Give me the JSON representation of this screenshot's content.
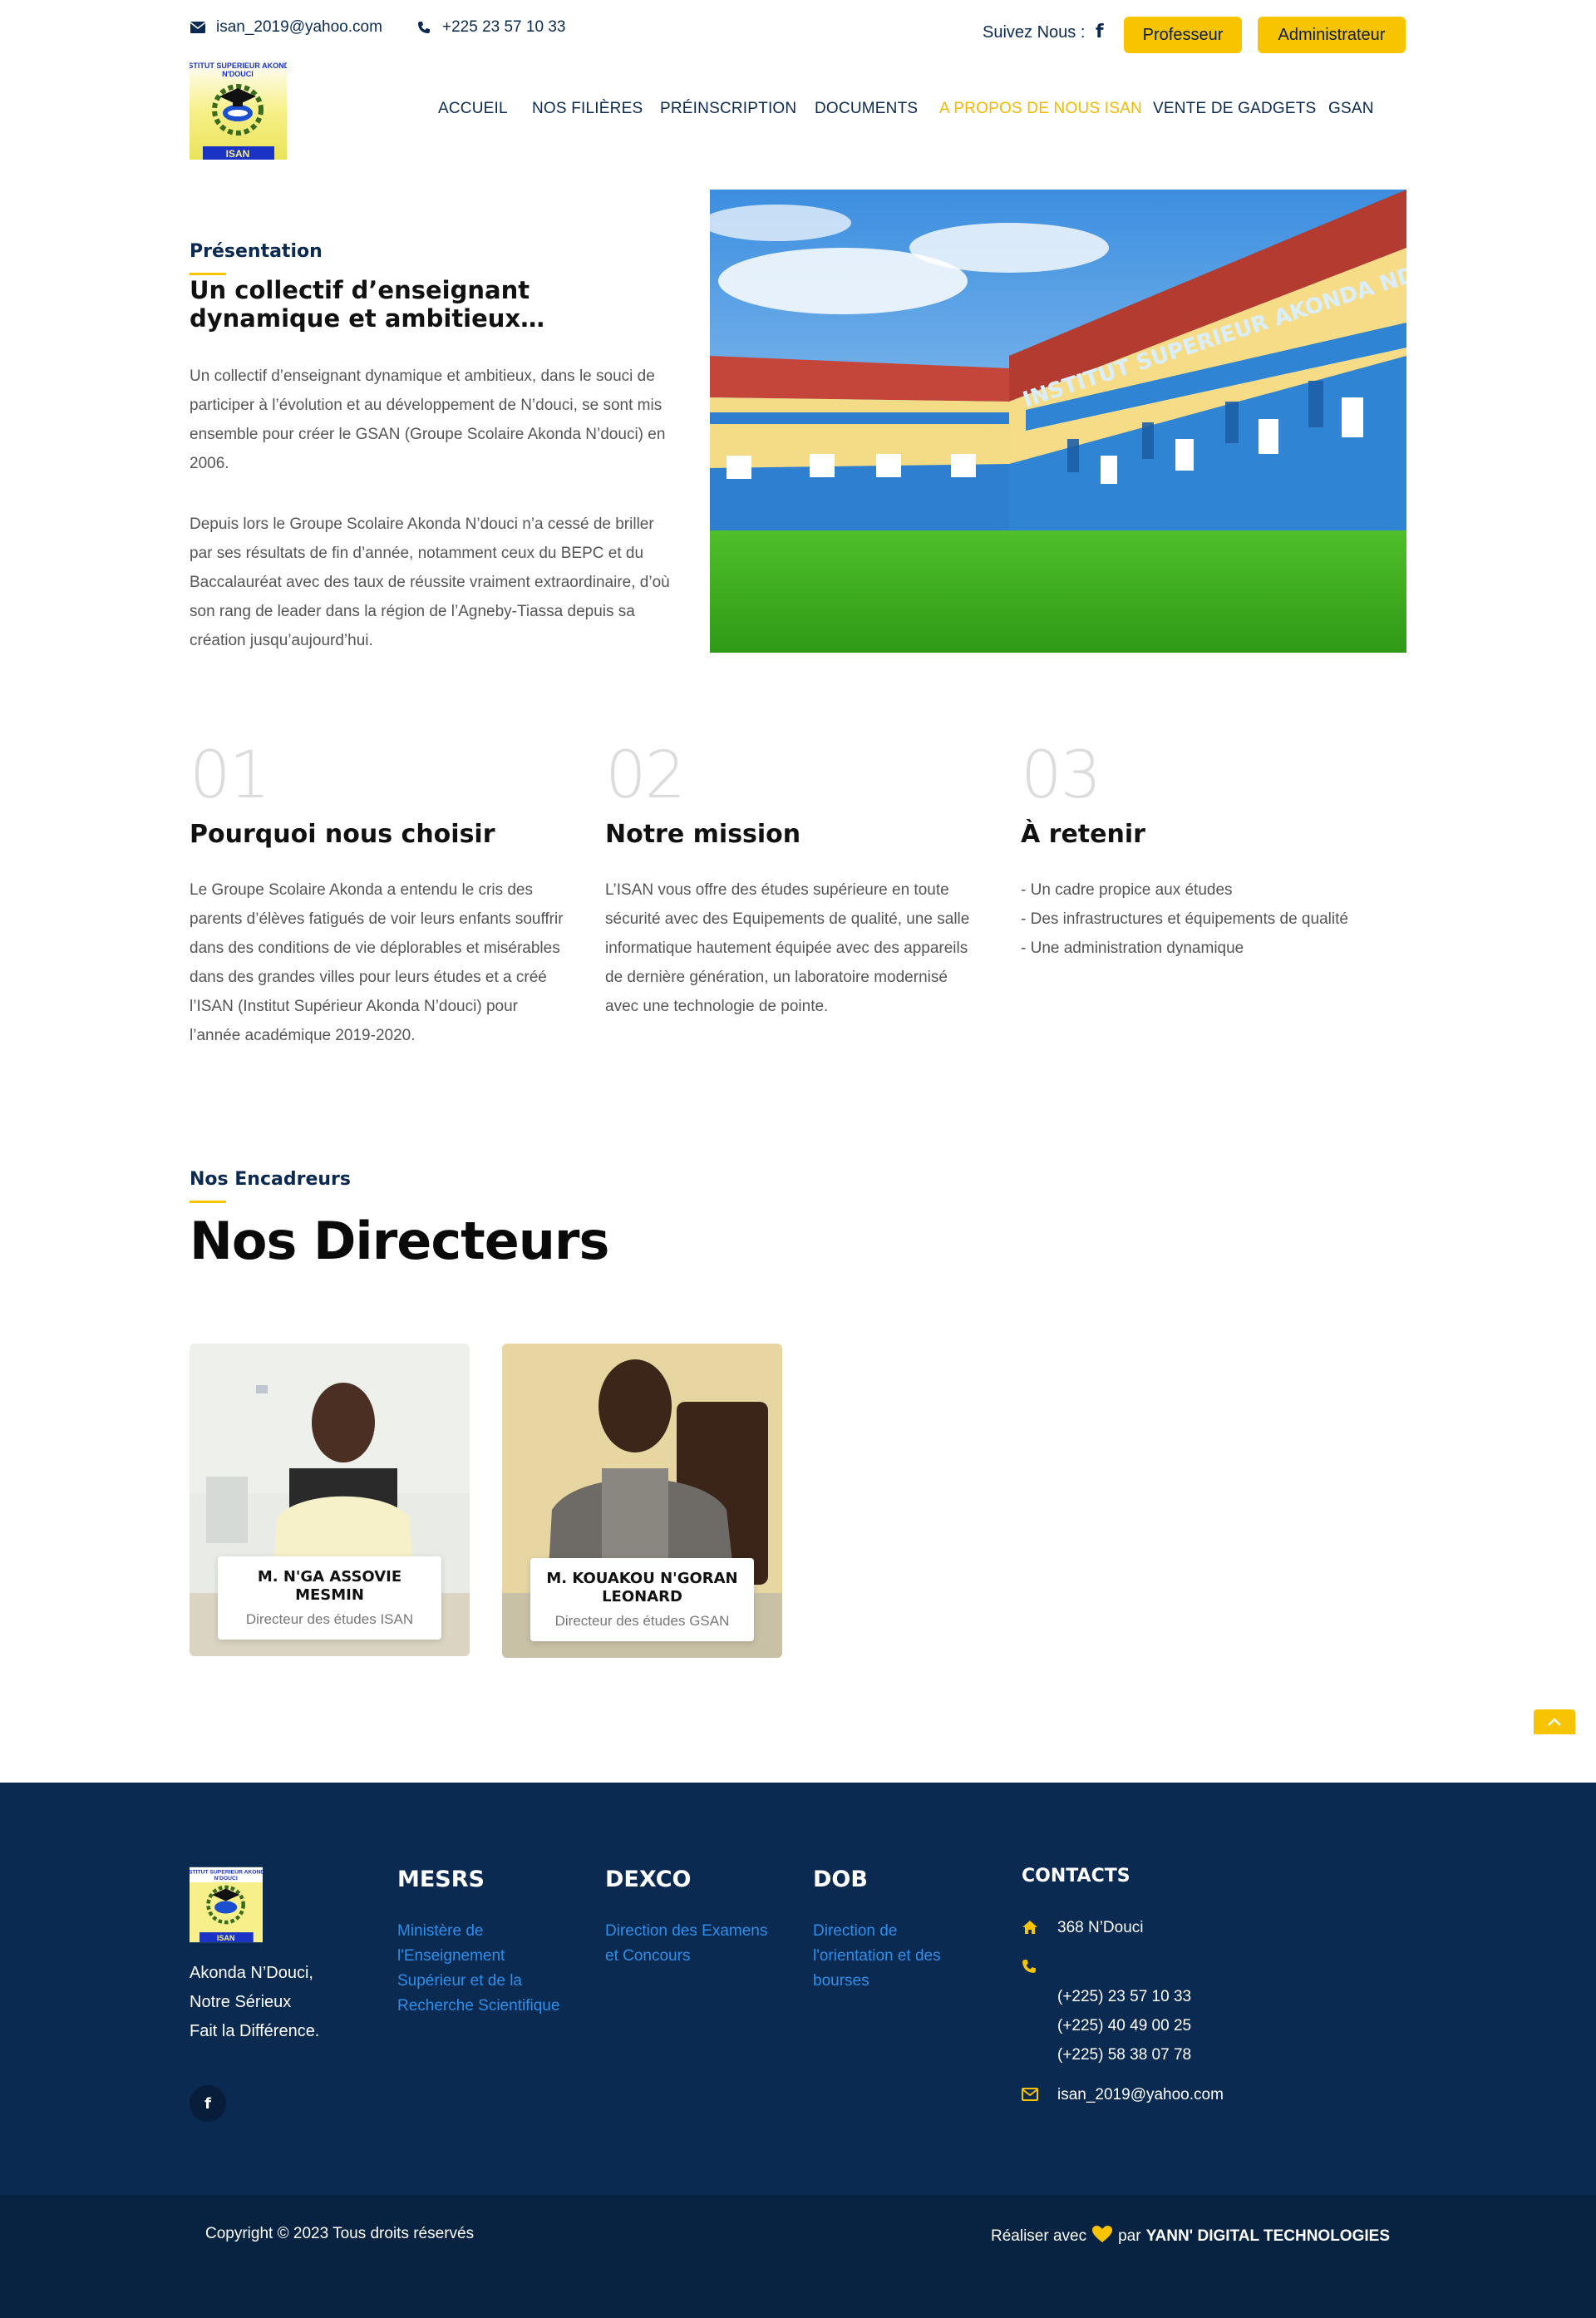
{
  "topbar": {
    "email": "isan_2019@yahoo.com",
    "phone": "+225 23 57 10 33",
    "follow_label": "Suivez Nous :",
    "facebook_glyph": "f",
    "btn_professeur": "Professeur",
    "btn_admin": "Administrateur"
  },
  "logo": {
    "line1": "INSTITUT SUPERIEUR AKONDA",
    "line2": "N'DOUCI",
    "line3": "ISAN"
  },
  "nav": {
    "items": [
      "ACCUEIL",
      "NOS FILIÈRES",
      "PRÉINSCRIPTION",
      "DOCUMENTS",
      "A PROPOS DE NOUS ISAN",
      "VENTE DE GADGETS",
      "GSAN"
    ],
    "active_index": 4
  },
  "presentation": {
    "eyebrow": "Présentation",
    "title": "Un collectif d’enseignant dynamique et ambitieux…",
    "para1": "Un collectif d’enseignant dynamique et ambitieux, dans le souci de participer à l’évolution et au développement de N’douci, se sont mis ensemble pour créer le GSAN (Groupe Scolaire Akonda N’douci) en 2006.",
    "para2": "Depuis lors le Groupe Scolaire Akonda N’douci n’a cessé de briller par ses résultats de fin d’année, notamment ceux du BEPC et du Baccalauréat avec des taux de réussite vraiment extraordinaire, d’où son rang de leader dans la région de l’Agneby-Tiassa depuis sa création jusqu’aujourd’hui.",
    "building_text": "INSTITUT SUPERIEUR AKONDA NDOUCI"
  },
  "features": [
    {
      "num": "01",
      "title": "Pourquoi nous choisir",
      "text": "Le Groupe Scolaire Akonda a entendu le cris des parents d’élèves fatigués de voir leurs enfants souffrir dans des conditions de vie déplorables et misérables dans des grandes villes pour leurs études et a créé l’ISAN (Institut Supérieur Akonda N’douci) pour l’année académique 2019-2020."
    },
    {
      "num": "02",
      "title": "Notre mission",
      "text": "L’ISAN vous offre des études supérieure en toute sécurité avec des Equipements de qualité, une salle informatique hautement équipée avec des appareils de dernière génération, un laboratoire modernisé avec une technologie de pointe."
    },
    {
      "num": "03",
      "title": "À retenir",
      "lines": [
        "- Un cadre propice aux études",
        "- Des infrastructures et équipements de qualité",
        "- Une administration dynamique"
      ]
    }
  ],
  "directors": {
    "eyebrow": "Nos Encadreurs",
    "title": "Nos Directeurs",
    "people": [
      {
        "name": "M. N'GA ASSOVIE MESMIN",
        "role": "Directeur des études ISAN"
      },
      {
        "name": "M. KOUAKOU N'GORAN LEONARD",
        "role": "Directeur des études GSAN"
      }
    ]
  },
  "footer": {
    "tagline": "Akonda N’Douci, Notre Sérieux Fait la Différence.",
    "columns": [
      {
        "heading": "MESRS",
        "link": "Ministère de l'Enseignement Supérieur et de la Recherche Scientifique"
      },
      {
        "heading": "DEXCO",
        "link": "Direction des Examens et Concours"
      },
      {
        "heading": "DOB",
        "link": "Direction de l'orientation et des bourses"
      }
    ],
    "contacts_heading": "CONTACTS",
    "address": "368 N’Douci",
    "phones": [
      "(+225) 23 57 10 33",
      "(+225) 40 49 00 25",
      "(+225) 58 38 07 78"
    ],
    "email": "isan_2019@yahoo.com",
    "copyright": "Copyright © 2023 Tous droits réservés",
    "credit_prefix": "Réaliser avec",
    "credit_mid": "par",
    "credit_company": "YANN' DIGITAL TECHNOLOGIES"
  },
  "colors": {
    "navy": "#0a2a52",
    "accent_yellow": "#f8c400",
    "link_blue": "#2f8fe8"
  }
}
